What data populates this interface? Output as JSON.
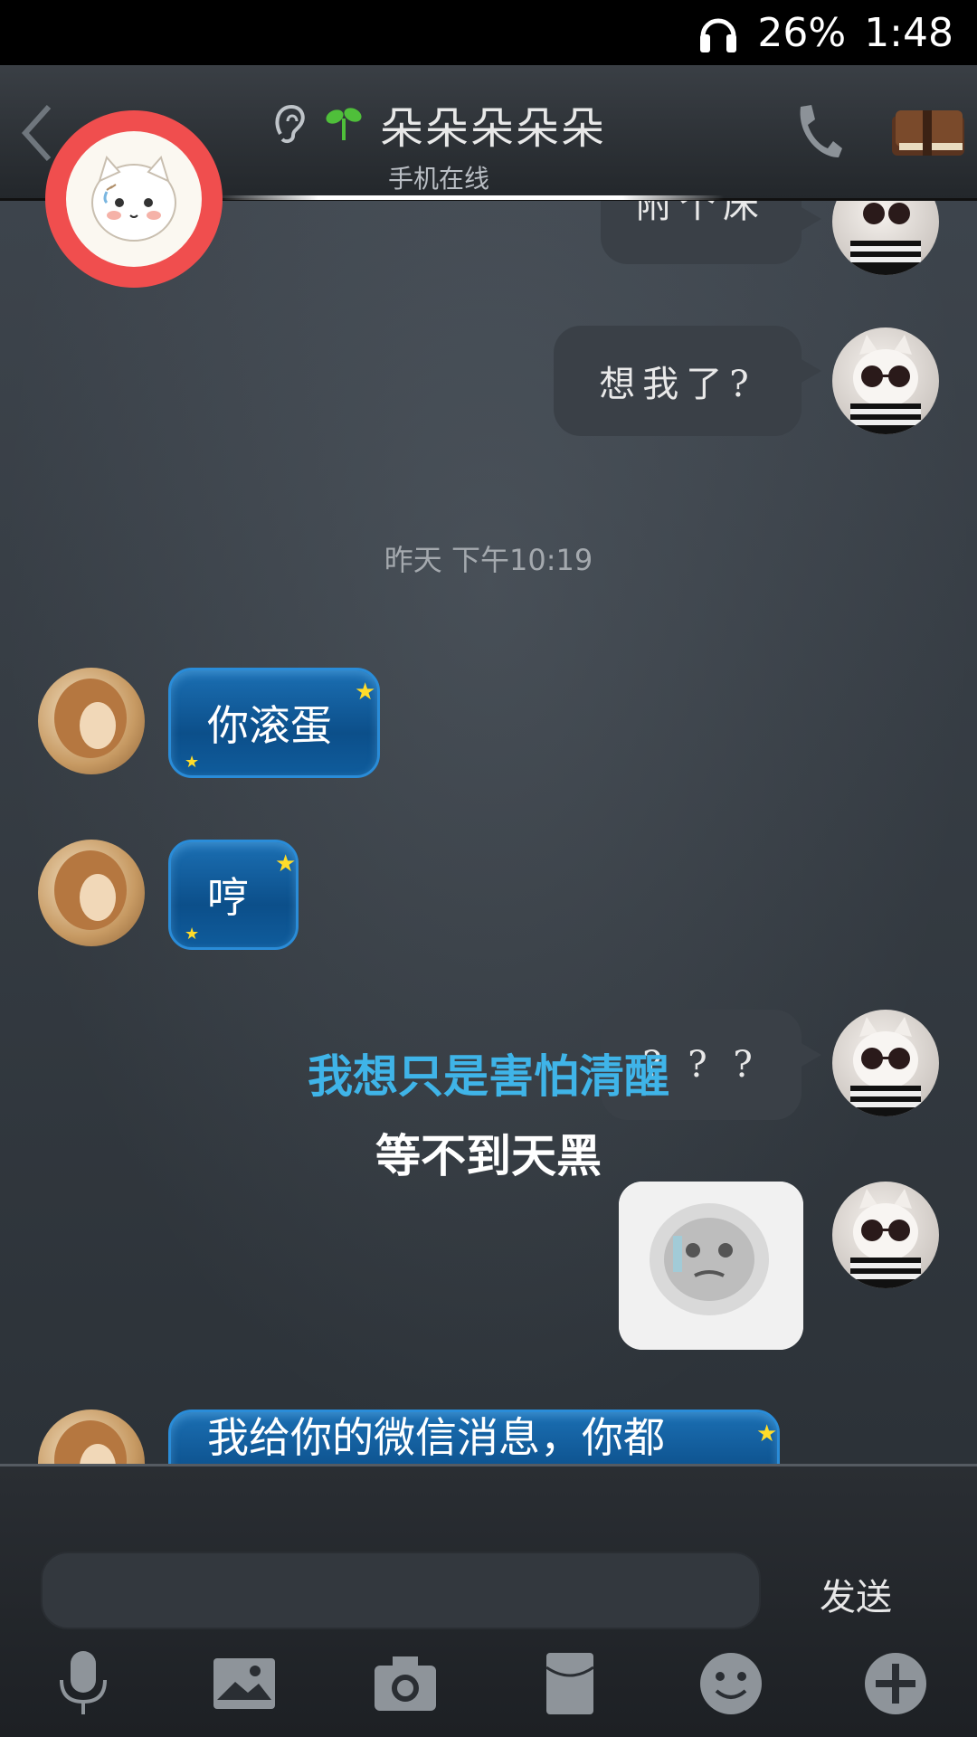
{
  "status_bar": {
    "battery": "26%",
    "time": "1:48",
    "icons": [
      "headphone-icon"
    ]
  },
  "header": {
    "title": "朵朵朵朵朵",
    "subtitle": "手机在线",
    "icons": [
      "back-icon",
      "ear-icon",
      "sprout-icon",
      "phone-icon",
      "book-icon"
    ]
  },
  "messages": {
    "partial_right": "附个床",
    "m1": "想我了?",
    "timestamp": "昨天 下午10:19",
    "m2": "你滚蛋",
    "m3": "哼",
    "m4": "? ? ?",
    "m5_partial": "我给你的微信消息，你都"
  },
  "overlay": {
    "lyric_line1": "我想只是害怕清醒",
    "lyric_line2": "等不到天黑"
  },
  "composer": {
    "send_label": "发送",
    "input_value": ""
  },
  "toolbar": {
    "icons": [
      "microphone-icon",
      "picture-icon",
      "camera-icon",
      "red-packet-icon",
      "emoji-icon",
      "plus-icon"
    ]
  }
}
